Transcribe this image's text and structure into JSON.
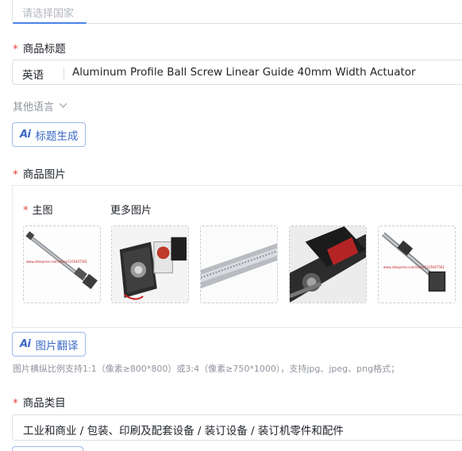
{
  "country": {
    "placeholder": "请选择国家"
  },
  "title_field": {
    "label": "商品标题",
    "language": "英语",
    "value": "Aluminum Profile Ball Screw Linear Guide 40mm Width Actuator"
  },
  "other_languages": {
    "label": "其他语言"
  },
  "title_ai_button": {
    "icon": "Ai",
    "label": "标题生成"
  },
  "images_field": {
    "label": "商品图片",
    "main_label": "主图",
    "more_label": "更多图片",
    "thumbnails": [
      {
        "name": "image-main",
        "watermark": "www.aliexpress.com/store/1105407561"
      },
      {
        "name": "image-more-1",
        "watermark": ""
      },
      {
        "name": "image-more-2",
        "watermark": ""
      },
      {
        "name": "image-more-3",
        "watermark": ""
      },
      {
        "name": "image-more-4",
        "watermark": "www.aliexpress.com/store/1105407561"
      }
    ]
  },
  "image_ai_button": {
    "icon": "Ai",
    "label": "图片翻译"
  },
  "image_hint": "图片横纵比例支持1:1（像素≥800*800）或3:4（像素≥750*1000），支持jpg、jpeg、png格式；",
  "category_field": {
    "label": "商品类目",
    "value": "工业和商业 / 包装、印刷及配套设备 / 装订设备 / 装订机零件和配件"
  },
  "colors": {
    "accent": "#3a68c6",
    "required": "#e6413a",
    "border": "#dcdfe6"
  }
}
